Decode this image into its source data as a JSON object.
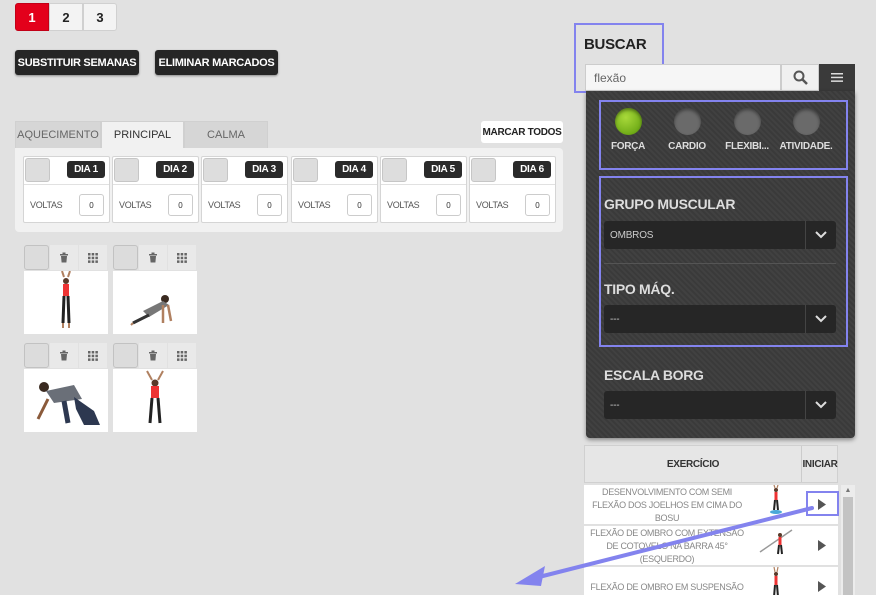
{
  "pagination": {
    "pages": [
      "1",
      "2",
      "3"
    ],
    "active": 0
  },
  "actions": {
    "replace_weeks": "SUBSTITUIR SEMANAS",
    "delete_marked": "ELIMINAR MARCADOS"
  },
  "tabs": {
    "warmup": "AQUECIMENTO",
    "main": "PRINCIPAL",
    "cooldown": "CALMA",
    "active": "PRINCIPAL"
  },
  "mark_all": "MARCAR TODOS",
  "days": [
    {
      "label": "DIA 1",
      "voltas_label": "VOLTAS",
      "voltas": "0"
    },
    {
      "label": "DIA 2",
      "voltas_label": "VOLTAS",
      "voltas": "0"
    },
    {
      "label": "DIA 3",
      "voltas_label": "VOLTAS",
      "voltas": "0"
    },
    {
      "label": "DIA 4",
      "voltas_label": "VOLTAS",
      "voltas": "0"
    },
    {
      "label": "DIA 5",
      "voltas_label": "VOLTAS",
      "voltas": "0"
    },
    {
      "label": "DIA 6",
      "voltas_label": "VOLTAS",
      "voltas": "0"
    }
  ],
  "search": {
    "title": "BUSCAR",
    "value": "flexão",
    "categories": [
      {
        "label": "FORÇA",
        "active": true
      },
      {
        "label": "CARDIO",
        "active": false
      },
      {
        "label": "FLEXIBI...",
        "active": false
      },
      {
        "label": "ATIVIDADE.",
        "active": false
      }
    ],
    "filters": {
      "muscle_group": {
        "label": "GRUPO MUSCULAR",
        "value": "OMBROS"
      },
      "machine_type": {
        "label": "TIPO MÁQ.",
        "value": "---"
      },
      "borg_scale": {
        "label": "ESCALA BORG",
        "value": "---"
      }
    }
  },
  "results": {
    "col_exercise": "EXERCÍCIO",
    "col_start": "INICIAR",
    "rows": [
      {
        "name": "DESENVOLVIMENTO COM SEMI FLEXÃO DOS JOELHOS EM CIMA DO BOSU"
      },
      {
        "name": "FLEXÃO DE OMBRO COM EXTENSÃO DE COTOVELO NA BARRA 45° (ESQUERDO)"
      },
      {
        "name": "FLEXÃO DE OMBRO EM SUSPENSÃO"
      }
    ]
  },
  "colors": {
    "accent_red": "#e3001b",
    "panel_dark": "#3d3d3d",
    "highlight": "#8383ee",
    "active_green": "#7ab51d"
  }
}
